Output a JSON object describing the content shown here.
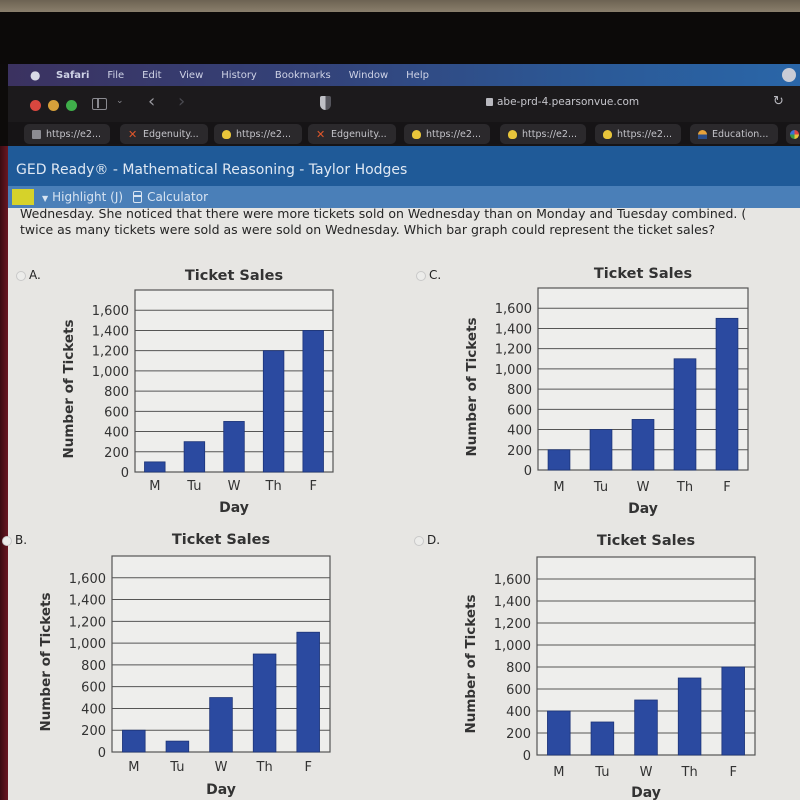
{
  "os_menu": {
    "apple_icon": "apple-icon",
    "items": [
      "Safari",
      "File",
      "Edit",
      "View",
      "History",
      "Bookmarks",
      "Window",
      "Help"
    ]
  },
  "browser": {
    "url": "abe-prd-4.pearsonvue.com",
    "tabs": [
      {
        "label": "https://e2...",
        "icon": "page-icon"
      },
      {
        "label": "Edgenuity...",
        "icon": "edgenuity-icon"
      },
      {
        "label": "https://e2...",
        "icon": "lightbulb-icon"
      },
      {
        "label": "Edgenuity...",
        "icon": "edgenuity-icon"
      },
      {
        "label": "https://e2...",
        "icon": "lightbulb-icon"
      },
      {
        "label": "https://e2...",
        "icon": "lightbulb-icon"
      },
      {
        "label": "https://e2...",
        "icon": "lightbulb-icon"
      },
      {
        "label": "Education...",
        "icon": "education-icon"
      },
      {
        "label": "",
        "icon": "google-icon"
      }
    ]
  },
  "app": {
    "title": "GED Ready® - Mathematical Reasoning - Taylor Hodges",
    "highlight_label": "Highlight (J)",
    "calculator_label": "Calculator",
    "highlight_color": "#d6d22a"
  },
  "question": {
    "line1": "Wednesday. She noticed that there were more tickets sold on Wednesday than on Monday and Tuesday combined. (",
    "line2": "twice as many tickets were sold as were sold on Wednesday. Which bar graph could represent the ticket sales?"
  },
  "options": [
    {
      "letter": "A."
    },
    {
      "letter": "C."
    },
    {
      "letter": "B."
    },
    {
      "letter": "D."
    }
  ],
  "chart_data": [
    {
      "option": "A",
      "type": "bar",
      "title": "Ticket Sales",
      "xlabel": "Day",
      "ylabel": "Number of Tickets",
      "categories": [
        "M",
        "Tu",
        "W",
        "Th",
        "F"
      ],
      "values": [
        100,
        300,
        500,
        1200,
        1400
      ],
      "yticks": [
        "0",
        "200",
        "400",
        "600",
        "800",
        "1,000",
        "1,200",
        "1,400",
        "1,600"
      ],
      "ylim": [
        0,
        1800
      ],
      "grid": true,
      "bar_color": "#2b4aa0"
    },
    {
      "option": "C",
      "type": "bar",
      "title": "Ticket Sales",
      "xlabel": "Day",
      "ylabel": "Number of Tickets",
      "categories": [
        "M",
        "Tu",
        "W",
        "Th",
        "F"
      ],
      "values": [
        200,
        400,
        500,
        1100,
        1500
      ],
      "yticks": [
        "0",
        "200",
        "400",
        "600",
        "800",
        "1,000",
        "1,200",
        "1,400",
        "1,600"
      ],
      "ylim": [
        0,
        1800
      ],
      "grid": true,
      "bar_color": "#2b4aa0"
    },
    {
      "option": "B",
      "type": "bar",
      "title": "Ticket Sales",
      "xlabel": "Day",
      "ylabel": "Number of Tickets",
      "categories": [
        "M",
        "Tu",
        "W",
        "Th",
        "F"
      ],
      "values": [
        200,
        100,
        500,
        900,
        1100
      ],
      "yticks": [
        "0",
        "200",
        "400",
        "600",
        "800",
        "1,000",
        "1,200",
        "1,400",
        "1,600"
      ],
      "ylim": [
        0,
        1800
      ],
      "grid": true,
      "bar_color": "#2b4aa0"
    },
    {
      "option": "D",
      "type": "bar",
      "title": "Ticket Sales",
      "xlabel": "Day",
      "ylabel": "Number of Tickets",
      "categories": [
        "M",
        "Tu",
        "W",
        "Th",
        "F"
      ],
      "values": [
        400,
        300,
        500,
        700,
        800
      ],
      "yticks": [
        "0",
        "200",
        "400",
        "600",
        "800",
        "1,000",
        "1,200",
        "1,400",
        "1,600"
      ],
      "ylim": [
        0,
        1800
      ],
      "grid": true,
      "bar_color": "#2b4aa0"
    }
  ]
}
